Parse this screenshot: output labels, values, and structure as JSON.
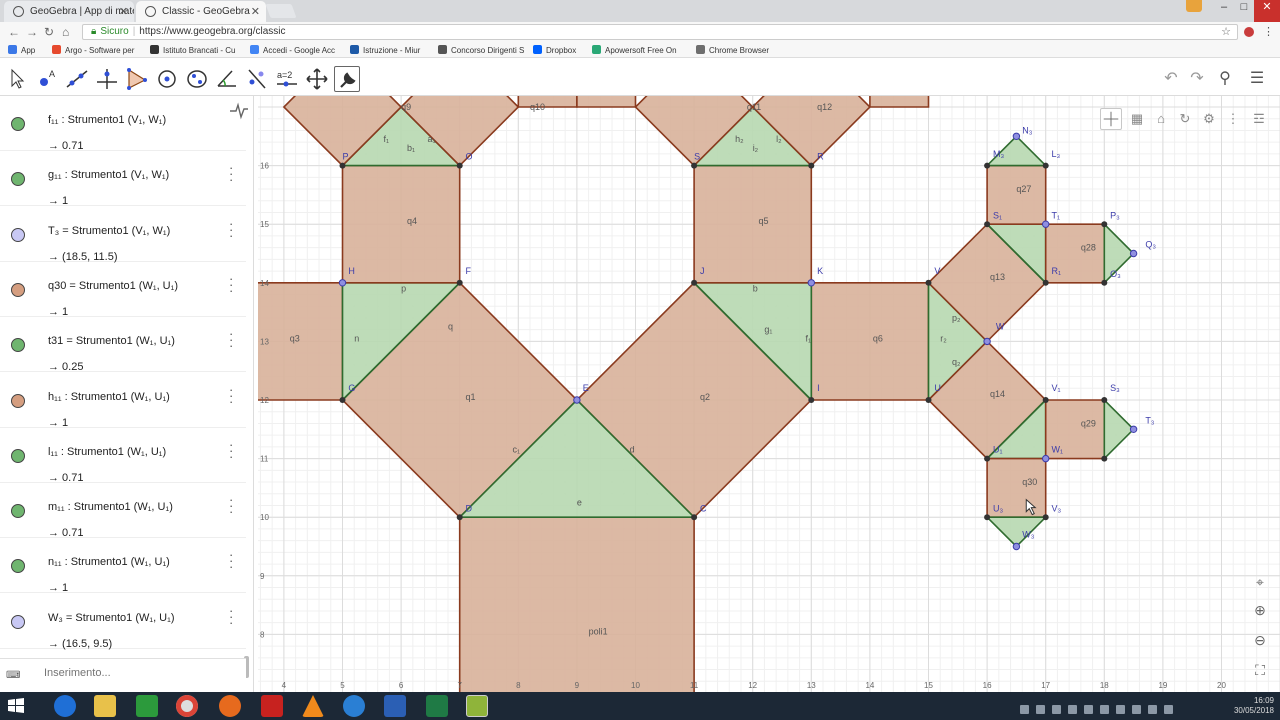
{
  "browser": {
    "tabs": [
      {
        "title": "GeoGebra | App di matematica"
      },
      {
        "title": "Classic - GeoGebra"
      }
    ],
    "window_controls": [
      "–",
      "□",
      "✕"
    ],
    "security_label": "Sicuro",
    "url": "https://www.geogebra.org/classic",
    "bookmarks": [
      {
        "label": "App",
        "color": "#3b78e7"
      },
      {
        "label": "Argo - Software per",
        "color": "#e64a2e"
      },
      {
        "label": "Istituto Brancati - Cu",
        "color": "#333333"
      },
      {
        "label": "Accedi - Google Acc",
        "color": "#4285f4"
      },
      {
        "label": "Istruzione - Miur",
        "color": "#1e5aa8"
      },
      {
        "label": "Concorso Dirigenti S",
        "color": "#555555"
      },
      {
        "label": "Dropbox",
        "color": "#0061fe"
      },
      {
        "label": "Apowersoft Free On",
        "color": "#2aa876"
      },
      {
        "label": "Chrome Browser",
        "color": "#6e6e6e"
      }
    ]
  },
  "algebra": {
    "items": [
      {
        "def": "f₁₁ : Strumento1 (V₁, W₁)",
        "value": "→  0.71",
        "color": "#6fb56f"
      },
      {
        "def": "g₁₁ : Strumento1 (V₁, W₁)",
        "value": "→  1",
        "color": "#6fb56f"
      },
      {
        "def": "T₃ = Strumento1 (V₁, W₁)",
        "value": "→  (18.5, 11.5)",
        "color": "#c8c8f4"
      },
      {
        "def": "q30 = Strumento1 (W₁, U₁)",
        "value": "→  1",
        "color": "#d59e80"
      },
      {
        "def": "t31 = Strumento1 (W₁, U₁)",
        "value": "→  0.25",
        "color": "#6fb56f"
      },
      {
        "def": "h₁₁ : Strumento1 (W₁, U₁)",
        "value": "→  1",
        "color": "#d59e80"
      },
      {
        "def": "l₁₁ : Strumento1 (W₁, U₁)",
        "value": "→  0.71",
        "color": "#6fb56f"
      },
      {
        "def": "m₁₁ : Strumento1 (W₁, U₁)",
        "value": "→  0.71",
        "color": "#6fb56f"
      },
      {
        "def": "n₁₁ : Strumento1 (W₁, U₁)",
        "value": "→  1",
        "color": "#6fb56f"
      },
      {
        "def": "W₃ = Strumento1 (W₁, U₁)",
        "value": "→  (16.5, 9.5)",
        "color": "#c8c8f4"
      }
    ],
    "input_placeholder": "Inserimento..."
  },
  "graphics": {
    "x_ticks": [
      "4",
      "5",
      "6",
      "7",
      "8",
      "9",
      "10",
      "11",
      "12",
      "13",
      "14",
      "15",
      "16",
      "17",
      "18",
      "19",
      "20"
    ],
    "y_ticks": [
      "8",
      "9",
      "10",
      "11",
      "12",
      "13",
      "14",
      "15",
      "16"
    ],
    "square_fill": "#d8b19a",
    "triangle_fill": "#b7d8b0",
    "labels": [
      {
        "t": "q9",
        "x": 6,
        "y": 16.95
      },
      {
        "t": "q10",
        "x": 8.2,
        "y": 16.95
      },
      {
        "t": "q11",
        "x": 11.9,
        "y": 16.95
      },
      {
        "t": "q12",
        "x": 13.1,
        "y": 16.95
      },
      {
        "t": "P",
        "x": 5,
        "y": 16.1
      },
      {
        "t": "O",
        "x": 7.1,
        "y": 16.1
      },
      {
        "t": "S",
        "x": 11,
        "y": 16.1
      },
      {
        "t": "R",
        "x": 13.1,
        "y": 16.1
      },
      {
        "t": "f₁",
        "x": 5.7,
        "y": 16.4
      },
      {
        "t": "b₁",
        "x": 6.1,
        "y": 16.25
      },
      {
        "t": "a₁",
        "x": 6.45,
        "y": 16.4
      },
      {
        "t": "h₂",
        "x": 11.7,
        "y": 16.4
      },
      {
        "t": "i₂",
        "x": 12,
        "y": 16.25
      },
      {
        "t": "l₂",
        "x": 12.4,
        "y": 16.4
      },
      {
        "t": "q4",
        "x": 6.1,
        "y": 15
      },
      {
        "t": "q5",
        "x": 12.1,
        "y": 15
      },
      {
        "t": "H",
        "x": 5.1,
        "y": 14.15
      },
      {
        "t": "F",
        "x": 7.1,
        "y": 14.15
      },
      {
        "t": "J",
        "x": 11.1,
        "y": 14.15
      },
      {
        "t": "K",
        "x": 13.1,
        "y": 14.15
      },
      {
        "t": "p",
        "x": 6,
        "y": 13.85
      },
      {
        "t": "b",
        "x": 12,
        "y": 13.85
      },
      {
        "t": "n",
        "x": 5.2,
        "y": 13
      },
      {
        "t": "q",
        "x": 6.8,
        "y": 13.2
      },
      {
        "t": "g₁",
        "x": 12.2,
        "y": 13.15
      },
      {
        "t": "f₁",
        "x": 12.9,
        "y": 13
      },
      {
        "t": "q3",
        "x": 4.1,
        "y": 13
      },
      {
        "t": "q6",
        "x": 14.05,
        "y": 13
      },
      {
        "t": "G",
        "x": 5.1,
        "y": 12.15
      },
      {
        "t": "q1",
        "x": 7.1,
        "y": 12
      },
      {
        "t": "E",
        "x": 9.1,
        "y": 12.15
      },
      {
        "t": "q2",
        "x": 11.1,
        "y": 12
      },
      {
        "t": "I",
        "x": 13.1,
        "y": 12.15
      },
      {
        "t": "c₁",
        "x": 7.9,
        "y": 11.1
      },
      {
        "t": "d",
        "x": 9.9,
        "y": 11.1
      },
      {
        "t": "e",
        "x": 9,
        "y": 10.2
      },
      {
        "t": "D",
        "x": 7.1,
        "y": 10.1
      },
      {
        "t": "C",
        "x": 11.1,
        "y": 10.1
      },
      {
        "t": "poli1",
        "x": 9.2,
        "y": 8
      },
      {
        "t": "N₃",
        "x": 16.6,
        "y": 16.55
      },
      {
        "t": "M₃",
        "x": 16.1,
        "y": 16.15
      },
      {
        "t": "L₃",
        "x": 17.1,
        "y": 16.15
      },
      {
        "t": "q27",
        "x": 16.5,
        "y": 15.55
      },
      {
        "t": "S₁",
        "x": 16.1,
        "y": 15.1
      },
      {
        "t": "T₁",
        "x": 17.1,
        "y": 15.1
      },
      {
        "t": "P₃",
        "x": 18.1,
        "y": 15.1
      },
      {
        "t": "q28",
        "x": 17.6,
        "y": 14.55
      },
      {
        "t": "Q₃",
        "x": 18.7,
        "y": 14.6
      },
      {
        "t": "R₁",
        "x": 17.1,
        "y": 14.15
      },
      {
        "t": "O₃",
        "x": 18.1,
        "y": 14.1
      },
      {
        "t": "V",
        "x": 15.1,
        "y": 14.15
      },
      {
        "t": "q13",
        "x": 16.05,
        "y": 14.05
      },
      {
        "t": "W",
        "x": 16.15,
        "y": 13.2
      },
      {
        "t": "p₂",
        "x": 15.4,
        "y": 13.35
      },
      {
        "t": "r₂",
        "x": 15.2,
        "y": 13
      },
      {
        "t": "q₂",
        "x": 15.4,
        "y": 12.6
      },
      {
        "t": "U",
        "x": 15.1,
        "y": 12.15
      },
      {
        "t": "q14",
        "x": 16.05,
        "y": 12.05
      },
      {
        "t": "V₁",
        "x": 17.1,
        "y": 12.15
      },
      {
        "t": "S₃",
        "x": 18.1,
        "y": 12.15
      },
      {
        "t": "q29",
        "x": 17.6,
        "y": 11.55
      },
      {
        "t": "T₃",
        "x": 18.7,
        "y": 11.6
      },
      {
        "t": "U₁",
        "x": 16.1,
        "y": 11.1
      },
      {
        "t": "W₁",
        "x": 17.1,
        "y": 11.1
      },
      {
        "t": "q30",
        "x": 16.6,
        "y": 10.55
      },
      {
        "t": "U₃",
        "x": 16.1,
        "y": 10.1
      },
      {
        "t": "V₃",
        "x": 17.1,
        "y": 10.1
      },
      {
        "t": "W₃",
        "x": 16.6,
        "y": 9.65
      }
    ]
  },
  "clock": {
    "time": "16:09",
    "date": "30/05/2018"
  }
}
